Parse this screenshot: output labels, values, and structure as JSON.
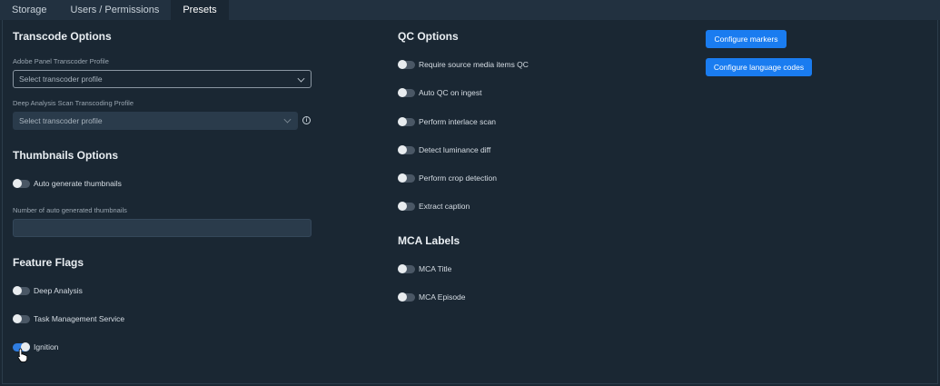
{
  "tabs": [
    {
      "label": "Storage",
      "active": false
    },
    {
      "label": "Users / Permissions",
      "active": false
    },
    {
      "label": "Presets",
      "active": true
    }
  ],
  "transcode": {
    "title": "Transcode Options",
    "adobe_label": "Adobe Panel Transcoder Profile",
    "adobe_placeholder": "Select transcoder profile",
    "deep_label": "Deep Analysis Scan Transcoding Profile",
    "deep_placeholder": "Select transcoder profile",
    "info_glyph": "i"
  },
  "thumbnails": {
    "title": "Thumbnails Options",
    "auto_generate": {
      "label": "Auto generate thumbnails",
      "on": false
    },
    "count_label": "Number of auto generated thumbnails",
    "count_value": ""
  },
  "feature_flags": {
    "title": "Feature Flags",
    "items": [
      {
        "label": "Deep Analysis",
        "on": false
      },
      {
        "label": "Task Management Service",
        "on": false
      },
      {
        "label": "Ignition",
        "on": true
      }
    ]
  },
  "qc": {
    "title": "QC Options",
    "items": [
      {
        "label": "Require source media items QC",
        "on": false
      },
      {
        "label": "Auto QC on ingest",
        "on": false
      },
      {
        "label": "Perform interlace scan",
        "on": false
      },
      {
        "label": "Detect luminance diff",
        "on": false
      },
      {
        "label": "Perform crop detection",
        "on": false
      },
      {
        "label": "Extract caption",
        "on": false
      }
    ]
  },
  "mca": {
    "title": "MCA Labels",
    "items": [
      {
        "label": "MCA Title",
        "on": false
      },
      {
        "label": "MCA Episode",
        "on": false
      }
    ]
  },
  "buttons": {
    "configure_markers": "Configure markers",
    "configure_language_codes": "Configure language codes"
  },
  "colors": {
    "background": "#1a2733",
    "tabbar": "#223140",
    "accent": "#1a7cf0",
    "toggle_off": "#4a5765"
  }
}
